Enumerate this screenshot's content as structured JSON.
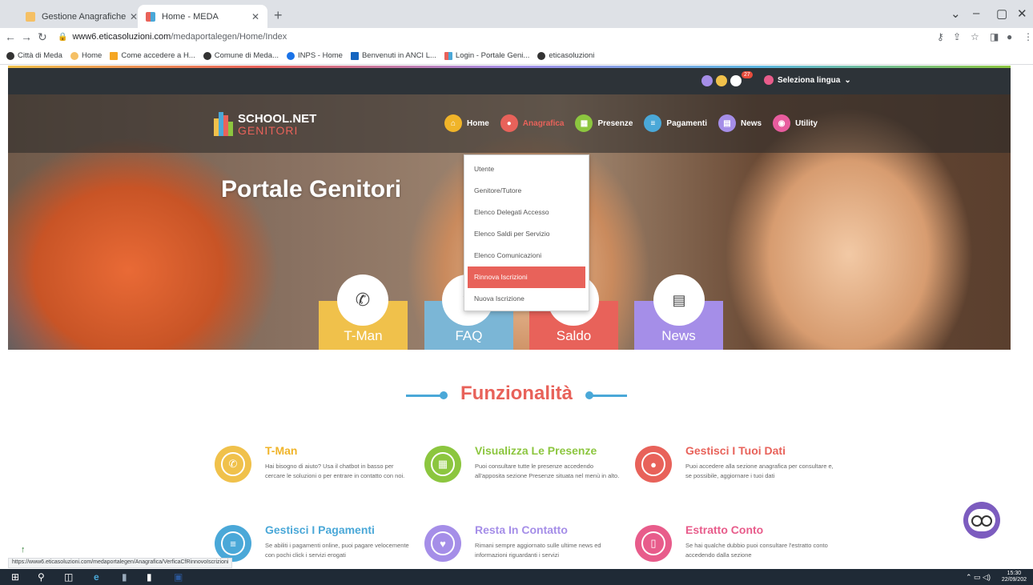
{
  "browser": {
    "tabs": [
      {
        "title": "Gestione Anagrafiche",
        "active": false
      },
      {
        "title": "Home - MEDA",
        "active": true
      }
    ],
    "url_host": "www6.eticasoluzioni.com",
    "url_path": "/medaportalegen/Home/Index",
    "bookmarks": [
      "Città di Meda",
      "Home",
      "Come accedere a H...",
      "Comune di Meda...",
      "INPS - Home",
      "Benvenuti in ANCI L...",
      "Login - Portale Geni...",
      "eticasoluzioni"
    ],
    "status_url": "https://www6.eticasoluzioni.com/medaportalegen/Anagrafica/VerficaCfRinnovoIscrizioni"
  },
  "topbar": {
    "notification_count": "27",
    "language_label": "Seleziona lingua"
  },
  "logo": {
    "line1": "SCHOOL.NET",
    "line2": "GENITORI"
  },
  "nav": [
    {
      "label": "Home",
      "color": "#f0b429",
      "icon": "home-icon"
    },
    {
      "label": "Anagrafica",
      "color": "#e8625a",
      "icon": "user-icon"
    },
    {
      "label": "Presenze",
      "color": "#8cc63f",
      "icon": "calendar-icon"
    },
    {
      "label": "Pagamenti",
      "color": "#4aa8d8",
      "icon": "list-icon"
    },
    {
      "label": "News",
      "color": "#a58ee8",
      "icon": "newspaper-icon"
    },
    {
      "label": "Utility",
      "color": "#e85c9e",
      "icon": "eye-icon"
    }
  ],
  "dropdown": [
    "Utente",
    "Genitore/Tutore",
    "Elenco Delegati Accesso",
    "Elenco Saldi per Servizio",
    "Elenco Comunicazioni",
    "Rinnova Iscrizioni",
    "Nuova Iscrizione"
  ],
  "dropdown_selected": "Rinnova Iscrizioni",
  "hero": {
    "title": "Portale Genitori"
  },
  "cards": [
    {
      "label": "T-Man",
      "color": "#f0c14b"
    },
    {
      "label": "FAQ",
      "color": "#7bb6d6"
    },
    {
      "label": "Saldo",
      "color": "#e8625a"
    },
    {
      "label": "News",
      "color": "#a58ee8"
    }
  ],
  "section_title": "Funzionalità",
  "features": [
    {
      "title": "T-Man",
      "color": "#f0c14b",
      "text": "Hai bisogno di aiuto? Usa il chatbot in basso per cercare le soluzioni o per entrare in contatto con noi."
    },
    {
      "title": "Visualizza Le Presenze",
      "color": "#8cc63f",
      "text": "Puoi consultare tutte le presenze accedendo all'apposita sezione Presenze situata nel menù in alto."
    },
    {
      "title": "Gestisci I Tuoi Dati",
      "color": "#e8625a",
      "text": "Puoi accedere alla sezione anagrafica per consultare e, se possibile, aggiornare i tuoi dati"
    },
    {
      "title": "Gestisci I Pagamenti",
      "color": "#4aa8d8",
      "text": "Se abiliti i pagamenti online, puoi pagare velocemente con pochi click i servizi erogati"
    },
    {
      "title": "Resta In Contatto",
      "color": "#a58ee8",
      "text": "Rimani sempre aggiornato sulle ultime news ed informazioni riguardanti i servizi"
    },
    {
      "title": "Estratto Conto",
      "color": "#e85c8b",
      "text": "Se hai qualche dubbio puoi consultare l'estratto conto accedendo dalla sezione"
    }
  ],
  "taskbar": {
    "time": "15:30",
    "date": "22/09/202"
  }
}
